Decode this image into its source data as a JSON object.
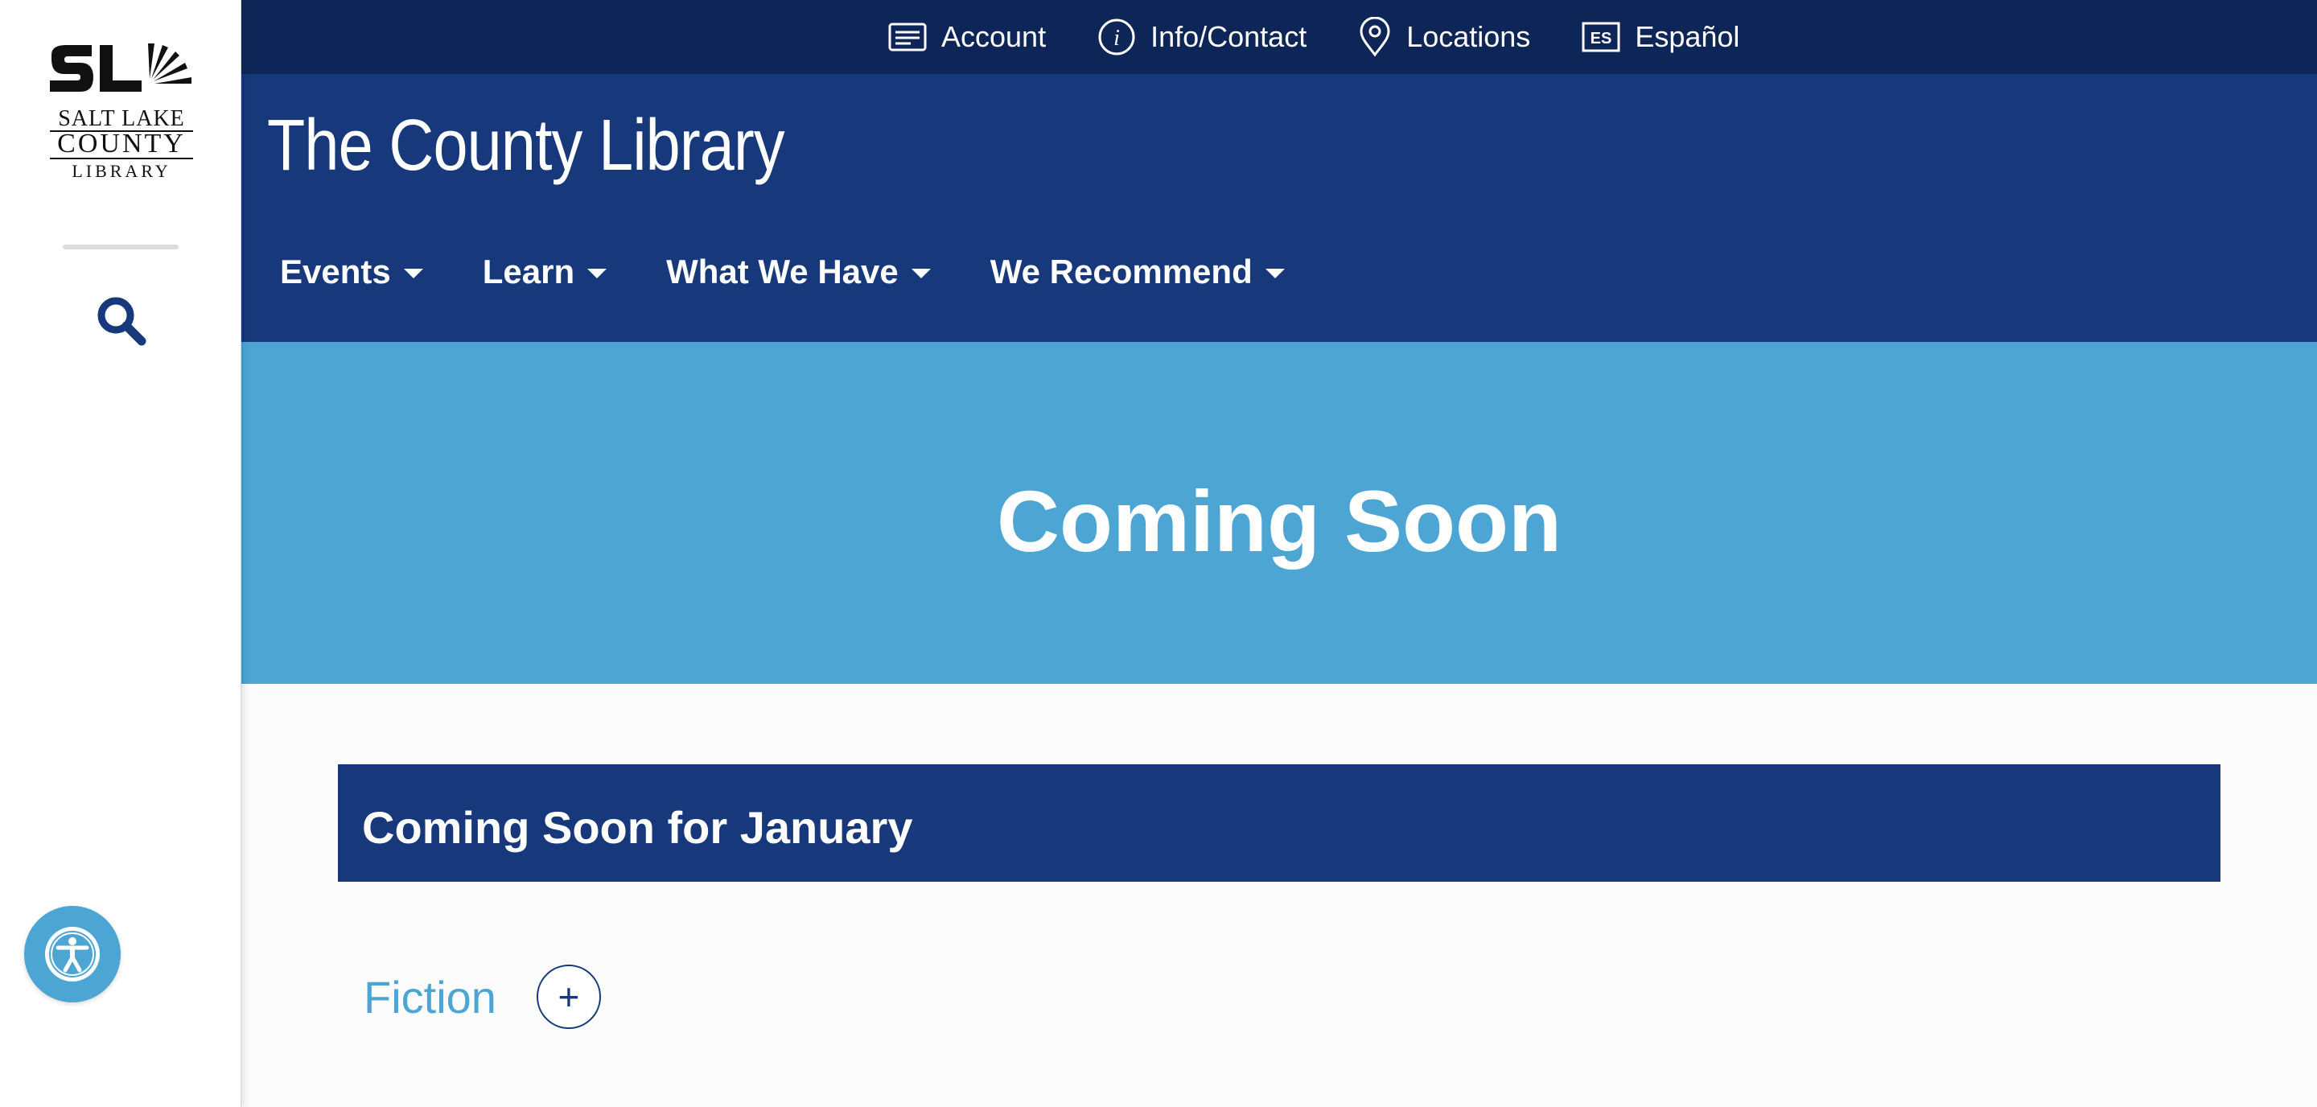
{
  "logo": {
    "line1": "SALT LAKE",
    "line2": "COUNTY",
    "line3": "LIBRARY"
  },
  "top_links": [
    {
      "label": "Account",
      "icon": "account-card-icon"
    },
    {
      "label": "Info/Contact",
      "icon": "info-icon"
    },
    {
      "label": "Locations",
      "icon": "location-pin-icon"
    },
    {
      "label": "Español",
      "icon": "es-language-icon",
      "icon_text": "ES"
    }
  ],
  "header": {
    "site_title": "The County Library"
  },
  "nav": [
    {
      "label": "Events"
    },
    {
      "label": "Learn"
    },
    {
      "label": "What We Have"
    },
    {
      "label": "We Recommend"
    }
  ],
  "hero": {
    "title": "Coming Soon"
  },
  "section": {
    "title": "Coming Soon for January"
  },
  "accordion": {
    "label": "Fiction",
    "toggle_symbol": "+"
  },
  "colors": {
    "topbar": "#0e2657",
    "header": "#17387a",
    "hero": "#4da5d3",
    "accent": "#4da5d3",
    "text_on_dark": "#ffffff"
  }
}
